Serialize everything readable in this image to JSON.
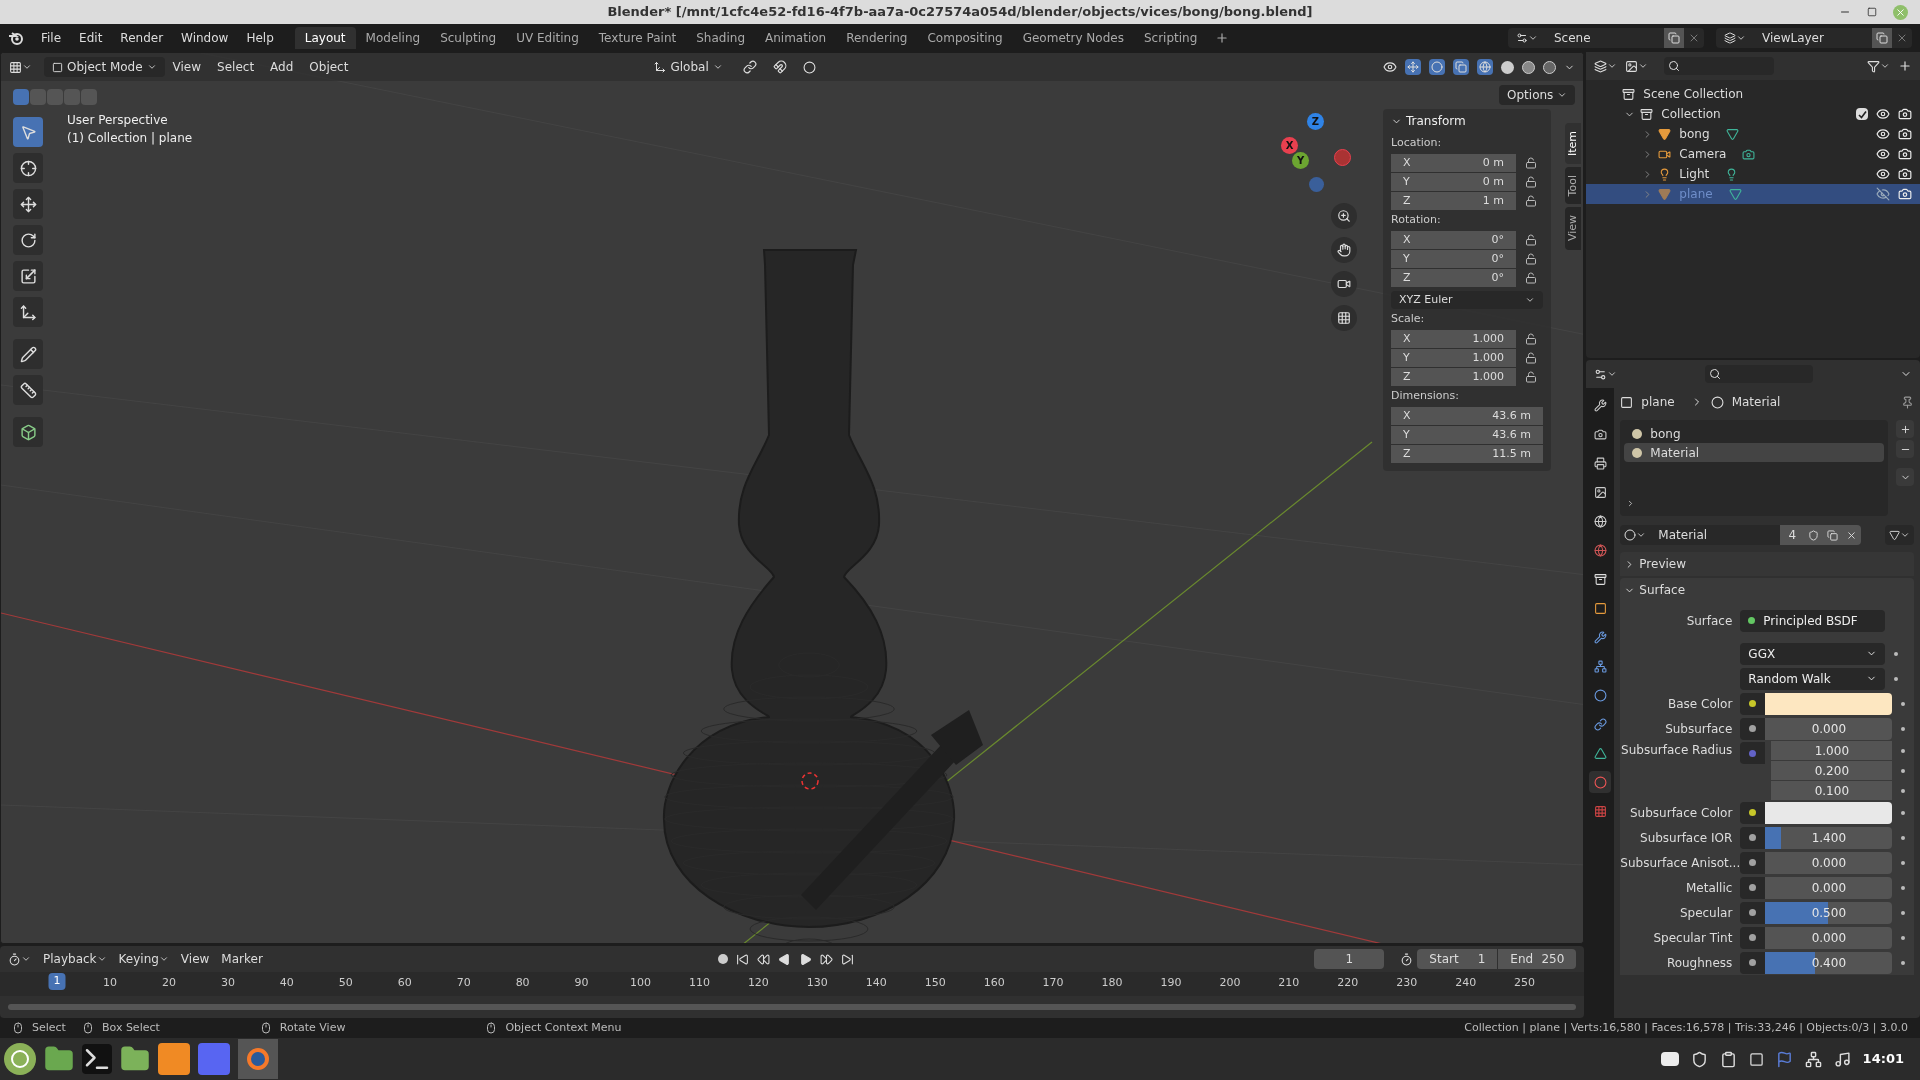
{
  "window": {
    "title": "Blender* [/mnt/1cfc4e52-fd16-4f7b-aa7a-0c27574a054d/blender/objects/vices/bong/bong.blend]"
  },
  "menu": [
    "File",
    "Edit",
    "Render",
    "Window",
    "Help"
  ],
  "workspaces": [
    {
      "label": "Layout",
      "selected": true
    },
    {
      "label": "Modeling",
      "selected": false
    },
    {
      "label": "Sculpting",
      "selected": false
    },
    {
      "label": "UV Editing",
      "selected": false
    },
    {
      "label": "Texture Paint",
      "selected": false
    },
    {
      "label": "Shading",
      "selected": false
    },
    {
      "label": "Animation",
      "selected": false
    },
    {
      "label": "Rendering",
      "selected": false
    },
    {
      "label": "Compositing",
      "selected": false
    },
    {
      "label": "Geometry Nodes",
      "selected": false
    },
    {
      "label": "Scripting",
      "selected": false
    }
  ],
  "scene": "Scene",
  "view_layer": "ViewLayer",
  "viewport_header": {
    "mode": "Object Mode",
    "menus": [
      "View",
      "Select",
      "Add",
      "Object"
    ],
    "orientation": "Global",
    "options": "Options"
  },
  "viewport_info": [
    "User Perspective",
    "(1) Collection | plane"
  ],
  "gizmo": [
    {
      "label": "Z",
      "color": "#2f83e6"
    },
    {
      "label": "X",
      "color": "#e8404f"
    },
    {
      "label": "Y",
      "color": "#6ca531"
    }
  ],
  "sidebar_tabs": [
    {
      "label": "Item",
      "selected": true
    },
    {
      "label": "Tool",
      "selected": false
    },
    {
      "label": "View",
      "selected": false
    }
  ],
  "transform": {
    "title": "Transform",
    "groups": [
      {
        "label": "Location:",
        "lockable": true,
        "fields": [
          {
            "axis": "X",
            "value": "0 m"
          },
          {
            "axis": "Y",
            "value": "0 m"
          },
          {
            "axis": "Z",
            "value": "1 m"
          }
        ]
      },
      {
        "label": "Rotation:",
        "lockable": true,
        "fields": [
          {
            "axis": "X",
            "value": "0°"
          },
          {
            "axis": "Y",
            "value": "0°"
          },
          {
            "axis": "Z",
            "value": "0°"
          }
        ],
        "mode": "XYZ Euler"
      },
      {
        "label": "Scale:",
        "lockable": true,
        "fields": [
          {
            "axis": "X",
            "value": "1.000"
          },
          {
            "axis": "Y",
            "value": "1.000"
          },
          {
            "axis": "Z",
            "value": "1.000"
          }
        ]
      },
      {
        "label": "Dimensions:",
        "lockable": false,
        "fields": [
          {
            "axis": "X",
            "value": "43.6 m"
          },
          {
            "axis": "Y",
            "value": "43.6 m"
          },
          {
            "axis": "Z",
            "value": "11.5 m"
          }
        ]
      }
    ]
  },
  "outliner": {
    "name": "Scene Collection",
    "kind": "scene",
    "children": [
      {
        "name": "Collection",
        "kind": "collection",
        "expanded": true,
        "checked": true,
        "visible": true,
        "selected": false,
        "children": [
          {
            "name": "bong",
            "kind": "mesh",
            "visible": true,
            "selected": false
          },
          {
            "name": "Camera",
            "kind": "camera",
            "visible": true,
            "selected": false
          },
          {
            "name": "Light",
            "kind": "light",
            "visible": true,
            "selected": false
          },
          {
            "name": "plane",
            "kind": "mesh",
            "visible": false,
            "selected": true
          }
        ]
      }
    ]
  },
  "properties": {
    "breadcrumb": [
      "plane",
      "Material"
    ],
    "material_slots": [
      {
        "name": "bong",
        "selected": false
      },
      {
        "name": "Material",
        "selected": true
      }
    ],
    "material": {
      "name": "Material",
      "users": "4"
    },
    "panels": [
      {
        "title": "Preview",
        "expanded": false
      },
      {
        "title": "Surface",
        "expanded": true
      }
    ],
    "rows": [
      {
        "kind": "shader",
        "label": "Surface",
        "value": "Principled BSDF"
      },
      {
        "kind": "dropdown",
        "value": "GGX"
      },
      {
        "kind": "dropdown",
        "value": "Random Walk"
      },
      {
        "kind": "color",
        "label": "Base Color",
        "color": "#fde7c1"
      },
      {
        "kind": "slider",
        "label": "Subsurface",
        "value": "0.000",
        "level": 0
      },
      {
        "kind": "vector",
        "label": "Subsurface Radius",
        "values": [
          "1.000",
          "0.200",
          "0.100"
        ]
      },
      {
        "kind": "color",
        "label": "Subsurface Color",
        "color": "#e8e8e8"
      },
      {
        "kind": "slider",
        "label": "Subsurface IOR",
        "value": "1.400",
        "level": 0.12
      },
      {
        "kind": "slider",
        "label": "Subsurface Anisot...",
        "value": "0.000",
        "level": 0
      },
      {
        "kind": "slider",
        "label": "Metallic",
        "value": "0.000",
        "level": 0
      },
      {
        "kind": "slider",
        "label": "Specular",
        "value": "0.500",
        "level": 0.49
      },
      {
        "kind": "slider",
        "label": "Specular Tint",
        "value": "0.000",
        "level": 0
      },
      {
        "kind": "slider",
        "label": "Roughness",
        "value": "0.400",
        "level": 0.39
      }
    ]
  },
  "timeline": {
    "menus": [
      "Playback",
      "Keying",
      "View",
      "Marker"
    ],
    "current_frame": "1",
    "start_label": "Start",
    "start": "1",
    "end_label": "End",
    "end": "250",
    "playhead": "1",
    "ticks": [
      "10",
      "20",
      "30",
      "40",
      "50",
      "60",
      "70",
      "80",
      "90",
      "100",
      "110",
      "120",
      "130",
      "140",
      "150",
      "160",
      "170",
      "180",
      "190",
      "200",
      "210",
      "220",
      "230",
      "240",
      "250"
    ]
  },
  "status_bar": {
    "hints": [
      "Select",
      "Box Select",
      "Rotate View",
      "Object Context Menu"
    ],
    "stats": "Collection | plane | Verts:16,580 | Faces:16,578 | Tris:33,246 | Objects:0/3 | 3.0.0"
  },
  "taskbar": {
    "clock": "14:01"
  }
}
